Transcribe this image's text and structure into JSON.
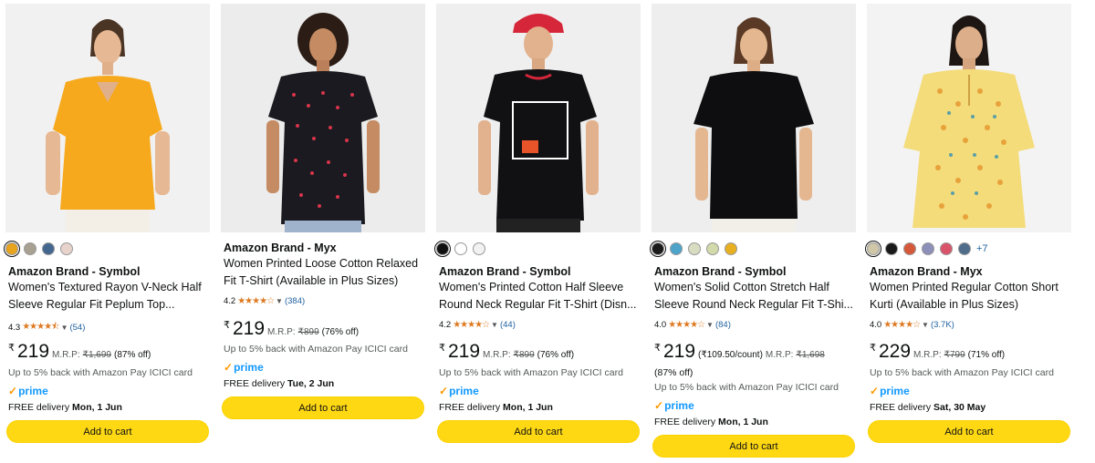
{
  "colors": {
    "button": "#FFD814",
    "link": "#2162A1",
    "prime": "#1399FF",
    "star": "#DE7921"
  },
  "products": [
    {
      "image": "woman-in-yellow-peplum-top",
      "swatches": [
        "#E8A41C",
        "#A8A090",
        "#44678F",
        "#E8D2CC"
      ],
      "brand": "Amazon Brand - Symbol",
      "title_lines": [
        "Women's Textured Rayon V-Neck Half",
        "Sleeve Regular Fit Peplum Top..."
      ],
      "rating": "4.3",
      "stars": "★★★★⯪",
      "reviews": "(54)",
      "currency": "₹",
      "price": "219",
      "mrp_label": "M.R.P:",
      "mrp": "₹1,699",
      "discount": "(87% off)",
      "cashback": "Up to 5% back with Amazon Pay ICICI card",
      "prime": "prime",
      "delivery_prefix": "FREE delivery",
      "delivery_date": "Mon, 1 Jun",
      "button": "Add to cart"
    },
    {
      "image": "woman-in-black-printed-tshirt",
      "swatches": [],
      "brand": "Amazon Brand - Myx",
      "title_lines": [
        "Women Printed Loose Cotton Relaxed",
        "Fit T-Shirt (Available in Plus Sizes)"
      ],
      "rating": "4.2",
      "stars": "★★★★☆",
      "reviews": "(384)",
      "currency": "₹",
      "price": "219",
      "mrp_label": "M.R.P:",
      "mrp": "₹899",
      "discount": "(76% off)",
      "cashback": "Up to 5% back with Amazon Pay ICICI card",
      "prime": "prime",
      "delivery_prefix": "FREE delivery",
      "delivery_date": "Tue, 2 Jun",
      "button": "Add to cart"
    },
    {
      "image": "woman-in-black-graphic-tshirt-red-cap",
      "swatches": [
        "#111111",
        "#FFFFFF",
        "#F2F2F2"
      ],
      "brand": "Amazon Brand - Symbol",
      "title_lines": [
        "Women's Printed Cotton Half Sleeve",
        "Round Neck Regular Fit T-Shirt (Disn..."
      ],
      "rating": "4.2",
      "stars": "★★★★☆",
      "reviews": "(44)",
      "currency": "₹",
      "price": "219",
      "mrp_label": "M.R.P:",
      "mrp": "₹899",
      "discount": "(76% off)",
      "cashback": "Up to 5% back with Amazon Pay ICICI card",
      "prime": "prime",
      "delivery_prefix": "FREE delivery",
      "delivery_date": "Mon, 1 Jun",
      "button": "Add to cart"
    },
    {
      "image": "woman-in-plain-black-tshirt",
      "swatches": [
        "#1A1A1A",
        "#4DA3C9",
        "#D8DCC0",
        "#D2D9AA",
        "#E8B020"
      ],
      "brand": "Amazon Brand - Symbol",
      "title_lines": [
        "Women's Solid Cotton Stretch Half",
        "Sleeve Round Neck Regular Fit T-Shi..."
      ],
      "rating": "4.0",
      "stars": "★★★★☆",
      "reviews": "(84)",
      "currency": "₹",
      "price": "219",
      "unit_price": "(₹109.50/count)",
      "mrp_label": "M.R.P:",
      "mrp": "₹1,698",
      "discount": "(87% off)",
      "cashback": "Up to 5% back with Amazon Pay ICICI card",
      "prime": "prime",
      "delivery_prefix": "FREE delivery",
      "delivery_date": "Mon, 1 Jun",
      "button": "Add to cart"
    },
    {
      "image": "woman-in-printed-yellow-kurti",
      "swatches": [
        "#CFC7A8",
        "#1A1A1A",
        "#D5583A",
        "#8C8FB8",
        "#D9536A",
        "#4F6C8A"
      ],
      "more_colors": "+7",
      "brand": "Amazon Brand - Myx",
      "title_lines": [
        "Women Printed Regular Cotton Short",
        "Kurti (Available in Plus Sizes)"
      ],
      "rating": "4.0",
      "stars": "★★★★☆",
      "reviews": "(3.7K)",
      "currency": "₹",
      "price": "229",
      "mrp_label": "M.R.P:",
      "mrp": "₹799",
      "discount": "(71% off)",
      "cashback": "Up to 5% back with Amazon Pay ICICI card",
      "prime": "prime",
      "delivery_prefix": "FREE delivery",
      "delivery_date": "Sat, 30 May",
      "button": "Add to cart"
    }
  ]
}
